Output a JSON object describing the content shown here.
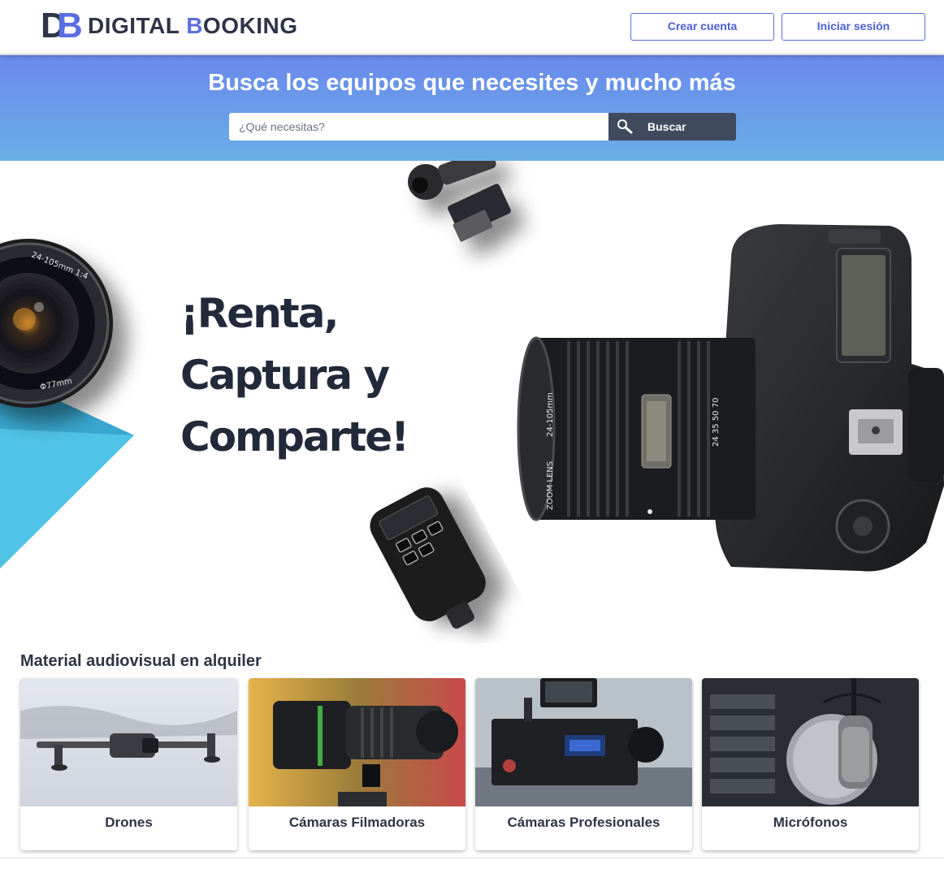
{
  "brand": {
    "name_part1": "DIGITAL ",
    "name_accent": "B",
    "name_part2": "OOKING"
  },
  "header": {
    "create_account": "Crear cuenta",
    "login": "Iniciar sesión"
  },
  "search": {
    "title": "Busca los equipos que necesites y mucho más",
    "placeholder": "¿Qué necesitas?",
    "button_label": "Buscar",
    "button_icon": "search-icon"
  },
  "hero": {
    "line1": "¡Renta,",
    "line2": "Captura y",
    "line3": "Comparte!",
    "lens_text_top": "24-105mm 1:4",
    "lens_text_bottom": "Φ77mm"
  },
  "categories": {
    "title": "Material audiovisual en alquiler",
    "items": [
      {
        "label": "Drones"
      },
      {
        "label": "Cámaras Filmadoras"
      },
      {
        "label": "Cámaras Profesionales"
      },
      {
        "label": "Micrófonos"
      }
    ]
  },
  "colors": {
    "accent": "#5b6ee1",
    "dark": "#2d3547",
    "band_top": "#6a89ec",
    "band_bottom": "#6aaee6",
    "teal": "#4fc3e6"
  }
}
